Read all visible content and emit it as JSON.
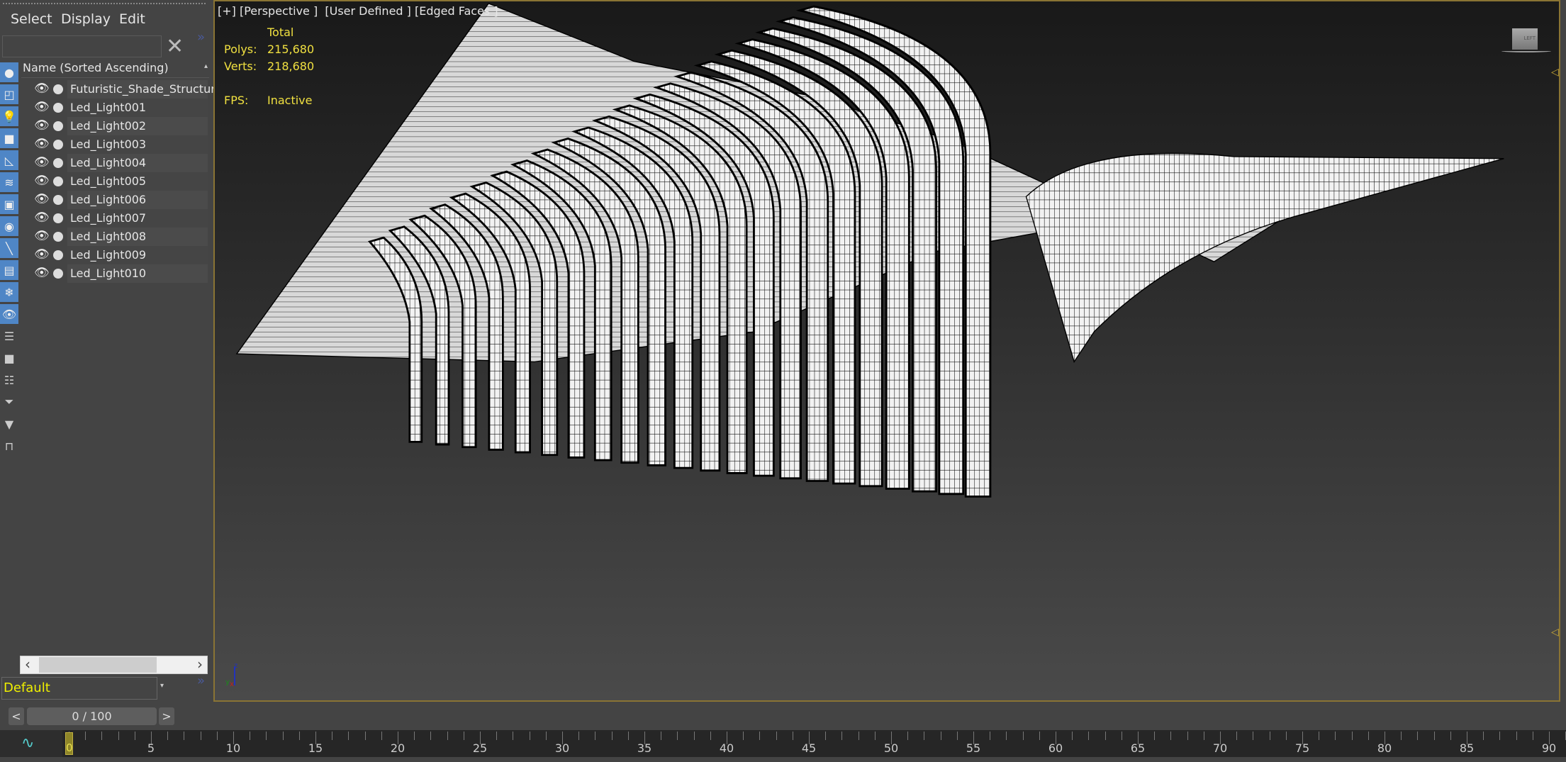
{
  "menu": [
    "Select",
    "Display",
    "Edit"
  ],
  "scene_explorer": {
    "search_placeholder": "",
    "column_header": "Name (Sorted Ascending)",
    "items": [
      "Futuristic_Shade_Structure",
      "Led_Light001",
      "Led_Light002",
      "Led_Light003",
      "Led_Light004",
      "Led_Light005",
      "Led_Light006",
      "Led_Light007",
      "Led_Light008",
      "Led_Light009",
      "Led_Light010"
    ],
    "toolbar_icons": [
      "geometry-icon",
      "shapes-icon",
      "lights-icon",
      "cameras-icon",
      "helpers-icon",
      "spacewarps-icon",
      "groups-icon",
      "xrefs-icon",
      "bones-icon",
      "containers-icon",
      "frozen-icon",
      "hidden-icon",
      "display-list-icon",
      "display-all-icon",
      "display-none-icon",
      "filter-settings-icon",
      "filter-icon",
      "layers-icon"
    ],
    "layer": "Default"
  },
  "viewport": {
    "label": "[+] [Perspective ]  [User Defined ] [Edged Faces ]",
    "stats": {
      "header": "Total",
      "polys_label": "Polys:",
      "polys": "215,680",
      "verts_label": "Verts:",
      "verts": "218,680",
      "fps_label": "FPS:",
      "fps": "Inactive"
    },
    "viewcube": "LEFT",
    "axes": {
      "x": "x",
      "y": "y",
      "z": "z"
    }
  },
  "timeline": {
    "frame": "0 / 100",
    "prev": "<",
    "next": ">",
    "current": "0",
    "labels": [
      "5",
      "10",
      "15",
      "20",
      "25",
      "30",
      "35",
      "40",
      "45",
      "50",
      "55",
      "60",
      "65",
      "70",
      "75",
      "80",
      "85",
      "90"
    ],
    "accent": "#c9a936"
  }
}
